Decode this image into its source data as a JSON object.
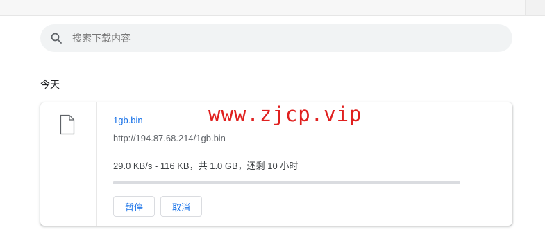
{
  "search": {
    "placeholder": "搜索下载内容"
  },
  "section": {
    "title": "今天"
  },
  "download": {
    "file_name": "1gb.bin",
    "url": "http://194.87.68.214/1gb.bin",
    "status": "29.0 KB/s - 116 KB，共 1.0 GB，还剩 10 小时",
    "progress_fraction": 0.0001,
    "pause_label": "暂停",
    "cancel_label": "取消"
  },
  "watermark": {
    "text": "www.zjcp.vip"
  },
  "colors": {
    "accent": "#1a73e8",
    "watermark": "#e0201f"
  },
  "icons": {
    "search": "search-icon",
    "file": "file-icon"
  }
}
